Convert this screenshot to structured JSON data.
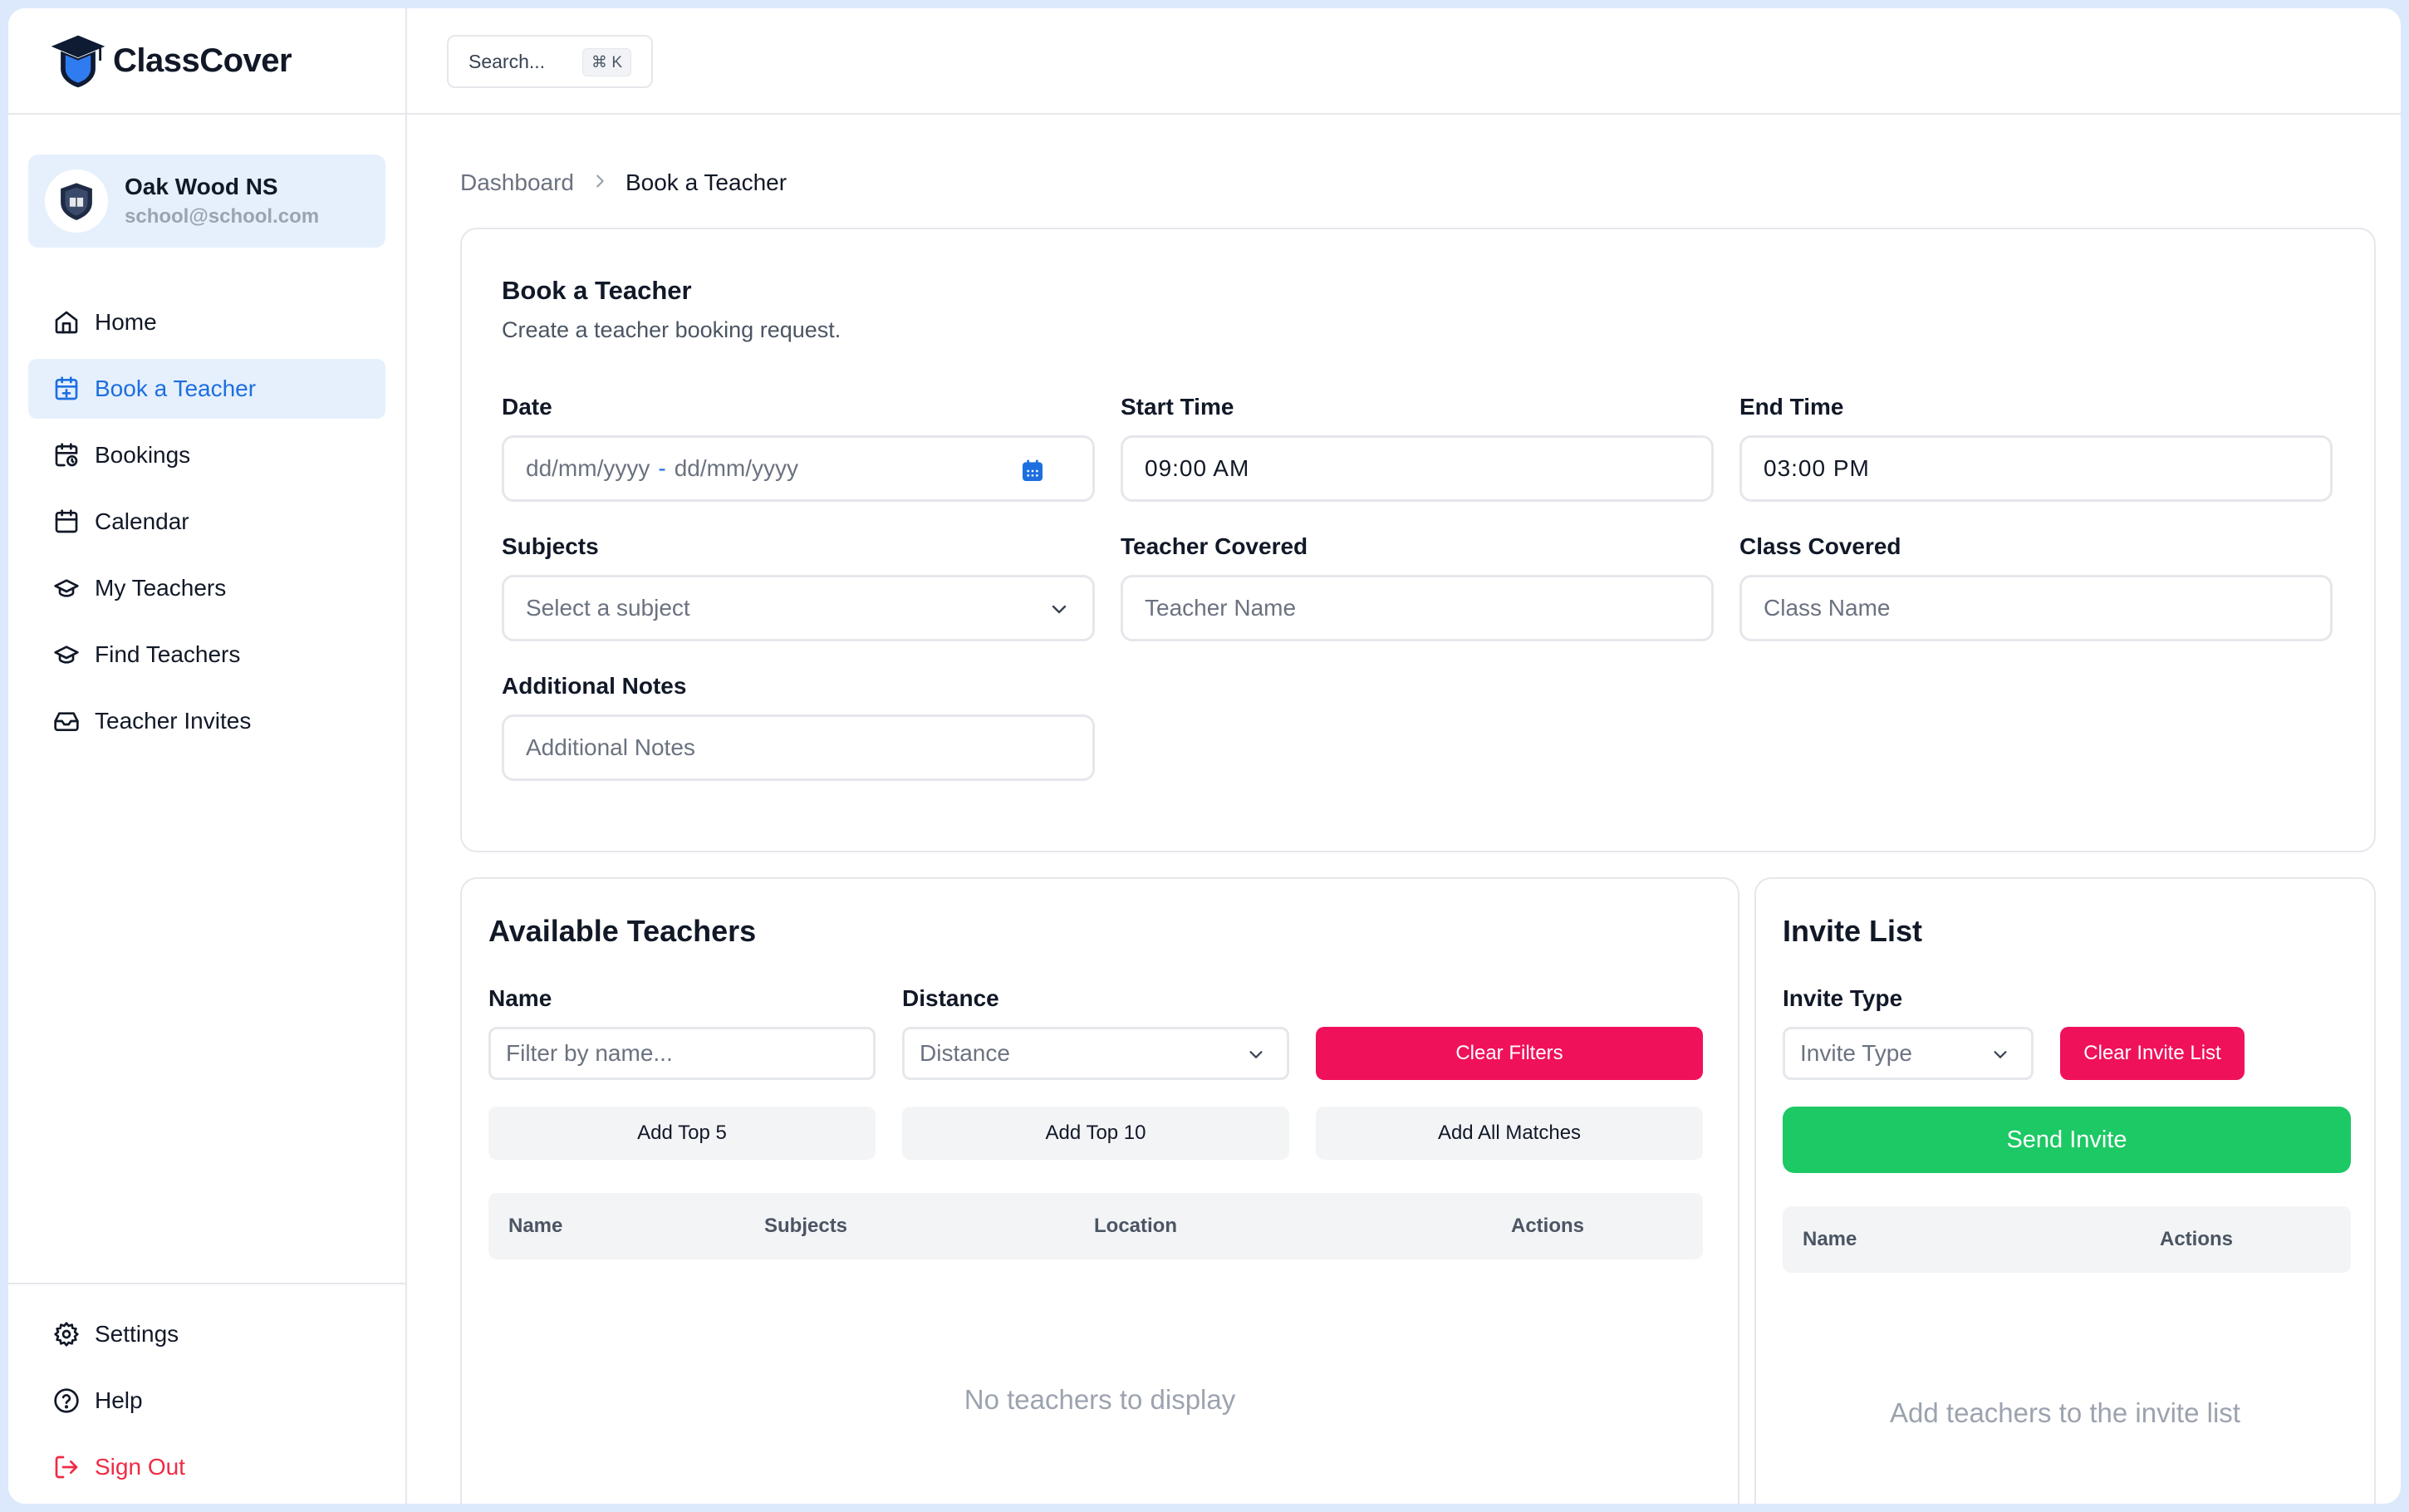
{
  "app": {
    "name": "ClassCover"
  },
  "search": {
    "placeholder": "Search...",
    "shortcut": "⌘ K"
  },
  "school": {
    "name": "Oak Wood NS",
    "email": "school@school.com"
  },
  "nav": {
    "items": [
      {
        "label": "Home",
        "icon": "home-icon"
      },
      {
        "label": "Book a Teacher",
        "icon": "calendar-plus-icon",
        "active": true
      },
      {
        "label": "Bookings",
        "icon": "calendar-clock-icon"
      },
      {
        "label": "Calendar",
        "icon": "calendar-icon"
      },
      {
        "label": "My Teachers",
        "icon": "graduation-cap-icon"
      },
      {
        "label": "Find Teachers",
        "icon": "graduation-cap-icon"
      },
      {
        "label": "Teacher Invites",
        "icon": "inbox-icon"
      }
    ],
    "bottom": [
      {
        "label": "Settings",
        "icon": "gear-icon"
      },
      {
        "label": "Help",
        "icon": "help-icon"
      },
      {
        "label": "Sign Out",
        "icon": "sign-out-icon"
      }
    ]
  },
  "breadcrumb": {
    "parent": "Dashboard",
    "current": "Book a Teacher"
  },
  "form": {
    "title": "Book a Teacher",
    "subtitle": "Create a teacher booking request.",
    "date": {
      "label": "Date",
      "start_placeholder": "dd/mm/yyyy",
      "separator": "-",
      "end_placeholder": "dd/mm/yyyy"
    },
    "start_time": {
      "label": "Start Time",
      "value": "09:00 AM"
    },
    "end_time": {
      "label": "End Time",
      "value": "03:00 PM"
    },
    "subjects": {
      "label": "Subjects",
      "value": "Select a subject"
    },
    "teacher_covered": {
      "label": "Teacher Covered",
      "placeholder": "Teacher Name"
    },
    "class_covered": {
      "label": "Class Covered",
      "placeholder": "Class Name"
    },
    "notes": {
      "label": "Additional Notes",
      "placeholder": "Additional Notes"
    }
  },
  "available": {
    "title": "Available Teachers",
    "name_label": "Name",
    "name_placeholder": "Filter by name...",
    "distance_label": "Distance",
    "distance_value": "Distance",
    "clear_filters": "Clear Filters",
    "add_top5": "Add Top 5",
    "add_top10": "Add Top 10",
    "add_all": "Add All Matches",
    "columns": [
      "Name",
      "Subjects",
      "Location",
      "Actions"
    ],
    "empty": "No teachers to display"
  },
  "invite": {
    "title": "Invite List",
    "type_label": "Invite Type",
    "type_value": "Invite Type",
    "clear": "Clear Invite List",
    "send": "Send Invite",
    "columns": [
      "Name",
      "Actions"
    ],
    "empty": "Add teachers to the invite list"
  },
  "colors": {
    "accent": "#1d6fe0",
    "danger": "#f0115b",
    "success": "#1cc964",
    "signout": "#ef2b45"
  }
}
